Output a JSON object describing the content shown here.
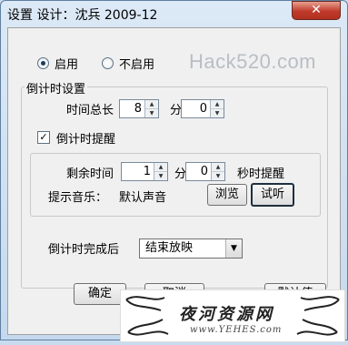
{
  "window": {
    "title": "设置  设计：沈兵 2009-12",
    "close_symbol": "✕"
  },
  "mode": {
    "enable_label": "启用",
    "disable_label": "不启用",
    "selected": "enable"
  },
  "watermark_top": "Hack520.com",
  "countdown": {
    "group_label": "倒计时设置",
    "total_label": "时间总长",
    "minutes_value": "8",
    "minutes_unit": "分",
    "seconds_value": "0"
  },
  "reminder": {
    "checkbox_label": "倒计时提醒",
    "checked": true,
    "remaining_label": "剩余时间",
    "minutes_value": "1",
    "minutes_unit": "分",
    "seconds_value": "0",
    "seconds_suffix": "秒时提醒",
    "music_label": "提示音乐：",
    "music_value": "默认声音",
    "browse_label": "浏览",
    "test_label": "试听"
  },
  "after": {
    "label": "倒计时完成后",
    "selected": "结束放映"
  },
  "buttons": {
    "ok": "确定",
    "cancel": "取消",
    "default": "默认值"
  },
  "seal": {
    "title": "夜河资源网",
    "url": "www.YEHES.com"
  }
}
